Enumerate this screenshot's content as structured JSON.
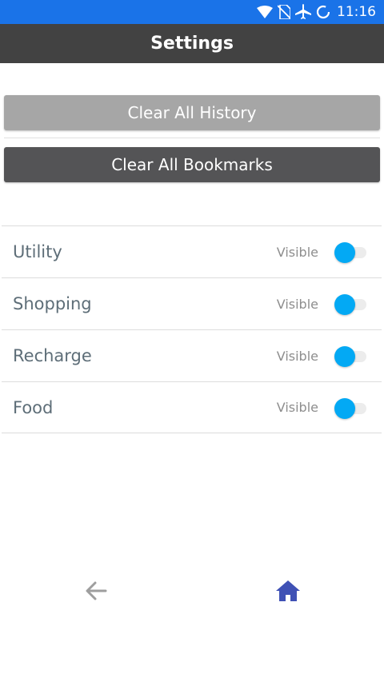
{
  "status_bar": {
    "time": "11:16",
    "icons": [
      "wifi-icon",
      "no-sim-icon",
      "airplane-mode-icon",
      "sync-icon"
    ]
  },
  "app_bar": {
    "title": "Settings"
  },
  "actions": {
    "clear_history_label": "Clear All History",
    "clear_bookmarks_label": "Clear All Bookmarks"
  },
  "categories": [
    {
      "label": "Utility",
      "status": "Visible",
      "enabled": true
    },
    {
      "label": "Shopping",
      "status": "Visible",
      "enabled": true
    },
    {
      "label": "Recharge",
      "status": "Visible",
      "enabled": true
    },
    {
      "label": "Food",
      "status": "Visible",
      "enabled": true
    }
  ],
  "bottom_nav": {
    "icons": [
      "back-arrow-icon",
      "home-icon"
    ]
  },
  "colors": {
    "status_bar": "#1a73e8",
    "app_bar": "#424242",
    "toggle_on": "#03a9f4",
    "home_icon": "#3f51b5",
    "back_icon": "#9e9e9e"
  }
}
